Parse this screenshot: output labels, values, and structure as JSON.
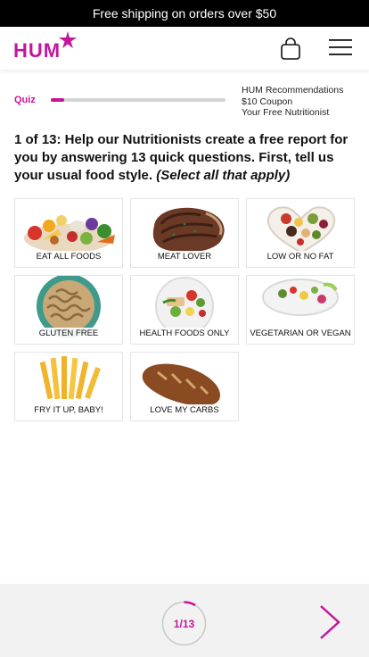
{
  "promo": {
    "text": "Free shipping on orders over $50"
  },
  "header": {
    "logo_text": "HUM",
    "icons": [
      "star-icon",
      "shopping-bag-icon",
      "hamburger-menu-icon"
    ]
  },
  "quiz": {
    "label": "Quiz",
    "progress_fraction": 0.077,
    "recommendations": [
      "HUM Recommendations",
      "$10 Coupon",
      "Your Free Nutritionist"
    ]
  },
  "question": {
    "text": "1 of 13: Help our Nutritionists create a free report for you by answering 13 quick questions. First, tell us your usual food style.",
    "hint": "(Select all that apply)"
  },
  "options": [
    {
      "label": "EAT ALL FOODS"
    },
    {
      "label": "MEAT LOVER"
    },
    {
      "label": "LOW OR NO FAT"
    },
    {
      "label": "GLUTEN FREE"
    },
    {
      "label": "HEALTH FOODS ONLY"
    },
    {
      "label": "VEGETARIAN OR VEGAN"
    },
    {
      "label": "FRY IT UP, BABY!"
    },
    {
      "label": "LOVE MY CARBS"
    }
  ],
  "footer": {
    "page_text": "1/13",
    "next_icon": "chevron-right-icon"
  },
  "colors": {
    "brand": "#c4169b",
    "promo_bg": "#000000",
    "footer_bg": "#f2f2f2"
  }
}
